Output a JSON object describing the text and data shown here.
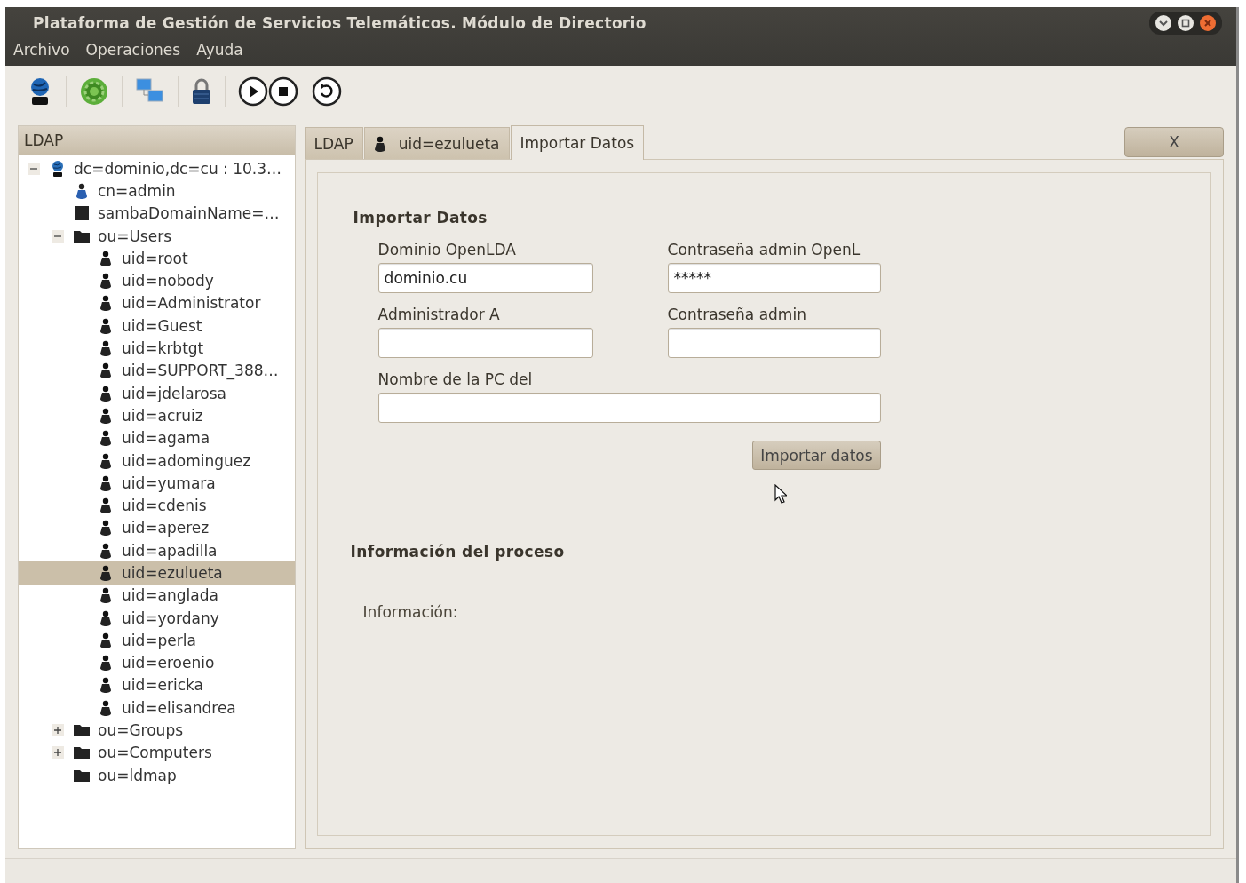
{
  "window": {
    "title": "Plataforma de Gestión de Servicios Telemáticos. Módulo de Directorio"
  },
  "menu": [
    "Archivo",
    "Operaciones",
    "Ayuda"
  ],
  "sidebar": {
    "title": "LDAP",
    "tree": [
      {
        "kind": "server",
        "label": "dc=dominio,dc=cu : 10.3…",
        "expanded": true,
        "selected": false,
        "children": [
          {
            "kind": "admin",
            "label": "cn=admin",
            "selected": false
          },
          {
            "kind": "domain",
            "label": "sambaDomainName=…",
            "selected": false
          },
          {
            "kind": "folder",
            "label": "ou=Users",
            "expanded": true,
            "selected": false,
            "children": [
              {
                "kind": "user",
                "label": "uid=root",
                "selected": false
              },
              {
                "kind": "user",
                "label": "uid=nobody",
                "selected": false
              },
              {
                "kind": "user",
                "label": "uid=Administrator",
                "selected": false
              },
              {
                "kind": "user",
                "label": "uid=Guest",
                "selected": false
              },
              {
                "kind": "user",
                "label": "uid=krbtgt",
                "selected": false
              },
              {
                "kind": "user",
                "label": "uid=SUPPORT_388…",
                "selected": false
              },
              {
                "kind": "user",
                "label": "uid=jdelarosa",
                "selected": false
              },
              {
                "kind": "user",
                "label": "uid=acruiz",
                "selected": false
              },
              {
                "kind": "user",
                "label": "uid=agama",
                "selected": false
              },
              {
                "kind": "user",
                "label": "uid=adominguez",
                "selected": false
              },
              {
                "kind": "user",
                "label": "uid=yumara",
                "selected": false
              },
              {
                "kind": "user",
                "label": "uid=cdenis",
                "selected": false
              },
              {
                "kind": "user",
                "label": "uid=aperez",
                "selected": false
              },
              {
                "kind": "user",
                "label": "uid=apadilla",
                "selected": false
              },
              {
                "kind": "user",
                "label": "uid=ezulueta",
                "selected": true
              },
              {
                "kind": "user",
                "label": "uid=anglada",
                "selected": false
              },
              {
                "kind": "user",
                "label": "uid=yordany",
                "selected": false
              },
              {
                "kind": "user",
                "label": "uid=perla",
                "selected": false
              },
              {
                "kind": "user",
                "label": "uid=eroenio",
                "selected": false
              },
              {
                "kind": "user",
                "label": "uid=ericka",
                "selected": false
              },
              {
                "kind": "user",
                "label": "uid=elisandrea",
                "selected": false
              }
            ]
          },
          {
            "kind": "folder",
            "label": "ou=Groups",
            "expanded": false,
            "selected": false
          },
          {
            "kind": "folder",
            "label": "ou=Computers",
            "expanded": false,
            "selected": false
          },
          {
            "kind": "folder",
            "label": "ou=ldmap",
            "selected": false
          }
        ]
      }
    ]
  },
  "tabs": [
    {
      "kind": "plain",
      "label": "LDAP",
      "selected": false
    },
    {
      "kind": "user",
      "label": "uid=ezulueta",
      "selected": false
    },
    {
      "kind": "plain",
      "label": "Importar Datos",
      "selected": true
    }
  ],
  "close_button": "X",
  "import_form": {
    "title": "Importar Datos",
    "fields": [
      {
        "kind": "half",
        "label": "Dominio OpenLDA",
        "value": "dominio.cu"
      },
      {
        "kind": "half",
        "label": "Contraseña admin OpenL",
        "value": "*****"
      },
      {
        "kind": "half",
        "label": "Administrador A"
      },
      {
        "kind": "half",
        "label": "Contraseña admin"
      },
      {
        "kind": "full",
        "label": "Nombre de la PC del"
      }
    ],
    "button": "Importar datos"
  },
  "process_info": {
    "title": "Información del proceso",
    "label": "Información:"
  }
}
